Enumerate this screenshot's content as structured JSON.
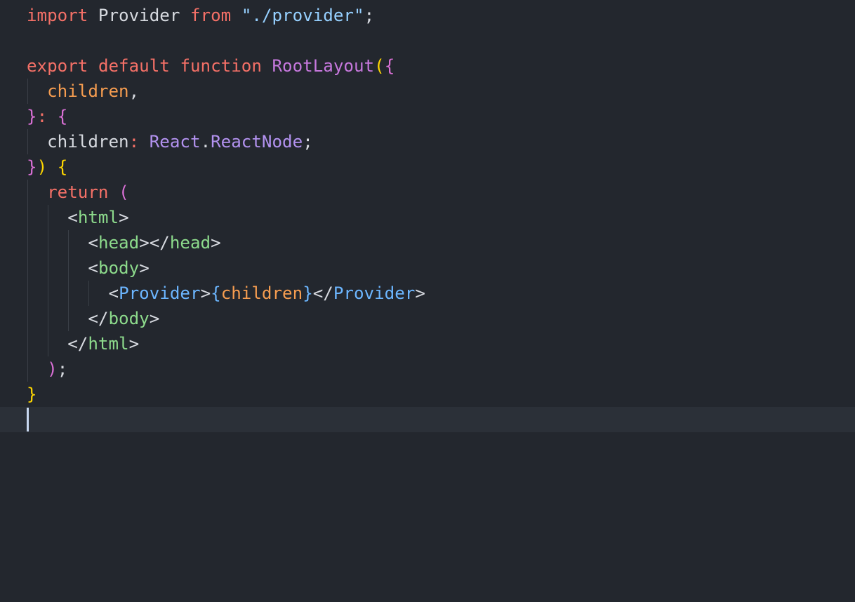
{
  "editor": {
    "colors": {
      "background": "#23272e",
      "current_line": "#2b3038",
      "keyword": "#f47067",
      "plain": "#d7dae0",
      "string": "#96d0ff",
      "function": "#c678dd",
      "bracket_yellow": "#ffd700",
      "bracket_pink": "#da70d6",
      "param": "#f69d50",
      "type": "#b392f0",
      "tag": "#8ddb8c",
      "component": "#6cb6ff"
    },
    "lines": [
      [
        {
          "t": "import",
          "c": "#f47067"
        },
        {
          "t": " Provider ",
          "c": "#d7dae0"
        },
        {
          "t": "from",
          "c": "#f47067"
        },
        {
          "t": " ",
          "c": "#d7dae0"
        },
        {
          "t": "\"./provider\"",
          "c": "#96d0ff"
        },
        {
          "t": ";",
          "c": "#d7dae0"
        }
      ],
      [],
      [
        {
          "t": "export",
          "c": "#f47067"
        },
        {
          "t": " ",
          "c": "#d7dae0"
        },
        {
          "t": "default",
          "c": "#f47067"
        },
        {
          "t": " ",
          "c": "#d7dae0"
        },
        {
          "t": "function",
          "c": "#f47067"
        },
        {
          "t": " ",
          "c": "#d7dae0"
        },
        {
          "t": "RootLayout",
          "c": "#c678dd"
        },
        {
          "t": "(",
          "c": "#ffd700"
        },
        {
          "t": "{",
          "c": "#da70d6"
        }
      ],
      [
        {
          "t": "  ",
          "c": "#d7dae0"
        },
        {
          "t": "children",
          "c": "#f69d50"
        },
        {
          "t": ",",
          "c": "#d7dae0"
        }
      ],
      [
        {
          "t": "}",
          "c": "#da70d6"
        },
        {
          "t": ": ",
          "c": "#f47067"
        },
        {
          "t": "{",
          "c": "#da70d6"
        }
      ],
      [
        {
          "t": "  children",
          "c": "#d7dae0"
        },
        {
          "t": ": ",
          "c": "#f47067"
        },
        {
          "t": "React",
          "c": "#b392f0"
        },
        {
          "t": ".",
          "c": "#d7dae0"
        },
        {
          "t": "ReactNode",
          "c": "#b392f0"
        },
        {
          "t": ";",
          "c": "#d7dae0"
        }
      ],
      [
        {
          "t": "}",
          "c": "#da70d6"
        },
        {
          "t": ")",
          "c": "#ffd700"
        },
        {
          "t": " ",
          "c": "#d7dae0"
        },
        {
          "t": "{",
          "c": "#ffd700"
        }
      ],
      [
        {
          "t": "  ",
          "c": "#d7dae0"
        },
        {
          "t": "return",
          "c": "#f47067"
        },
        {
          "t": " ",
          "c": "#d7dae0"
        },
        {
          "t": "(",
          "c": "#da70d6"
        }
      ],
      [
        {
          "t": "    <",
          "c": "#d7dae0"
        },
        {
          "t": "html",
          "c": "#8ddb8c"
        },
        {
          "t": ">",
          "c": "#d7dae0"
        }
      ],
      [
        {
          "t": "      <",
          "c": "#d7dae0"
        },
        {
          "t": "head",
          "c": "#8ddb8c"
        },
        {
          "t": "></",
          "c": "#d7dae0"
        },
        {
          "t": "head",
          "c": "#8ddb8c"
        },
        {
          "t": ">",
          "c": "#d7dae0"
        }
      ],
      [
        {
          "t": "      <",
          "c": "#d7dae0"
        },
        {
          "t": "body",
          "c": "#8ddb8c"
        },
        {
          "t": ">",
          "c": "#d7dae0"
        }
      ],
      [
        {
          "t": "        <",
          "c": "#d7dae0"
        },
        {
          "t": "Provider",
          "c": "#6cb6ff"
        },
        {
          "t": ">",
          "c": "#d7dae0"
        },
        {
          "t": "{",
          "c": "#6cb6ff"
        },
        {
          "t": "children",
          "c": "#f69d50"
        },
        {
          "t": "}",
          "c": "#6cb6ff"
        },
        {
          "t": "</",
          "c": "#d7dae0"
        },
        {
          "t": "Provider",
          "c": "#6cb6ff"
        },
        {
          "t": ">",
          "c": "#d7dae0"
        }
      ],
      [
        {
          "t": "      </",
          "c": "#d7dae0"
        },
        {
          "t": "body",
          "c": "#8ddb8c"
        },
        {
          "t": ">",
          "c": "#d7dae0"
        }
      ],
      [
        {
          "t": "    </",
          "c": "#d7dae0"
        },
        {
          "t": "html",
          "c": "#8ddb8c"
        },
        {
          "t": ">",
          "c": "#d7dae0"
        }
      ],
      [
        {
          "t": "  ",
          "c": "#d7dae0"
        },
        {
          "t": ")",
          "c": "#da70d6"
        },
        {
          "t": ";",
          "c": "#d7dae0"
        }
      ],
      [
        {
          "t": "}",
          "c": "#ffd700"
        }
      ],
      []
    ]
  }
}
